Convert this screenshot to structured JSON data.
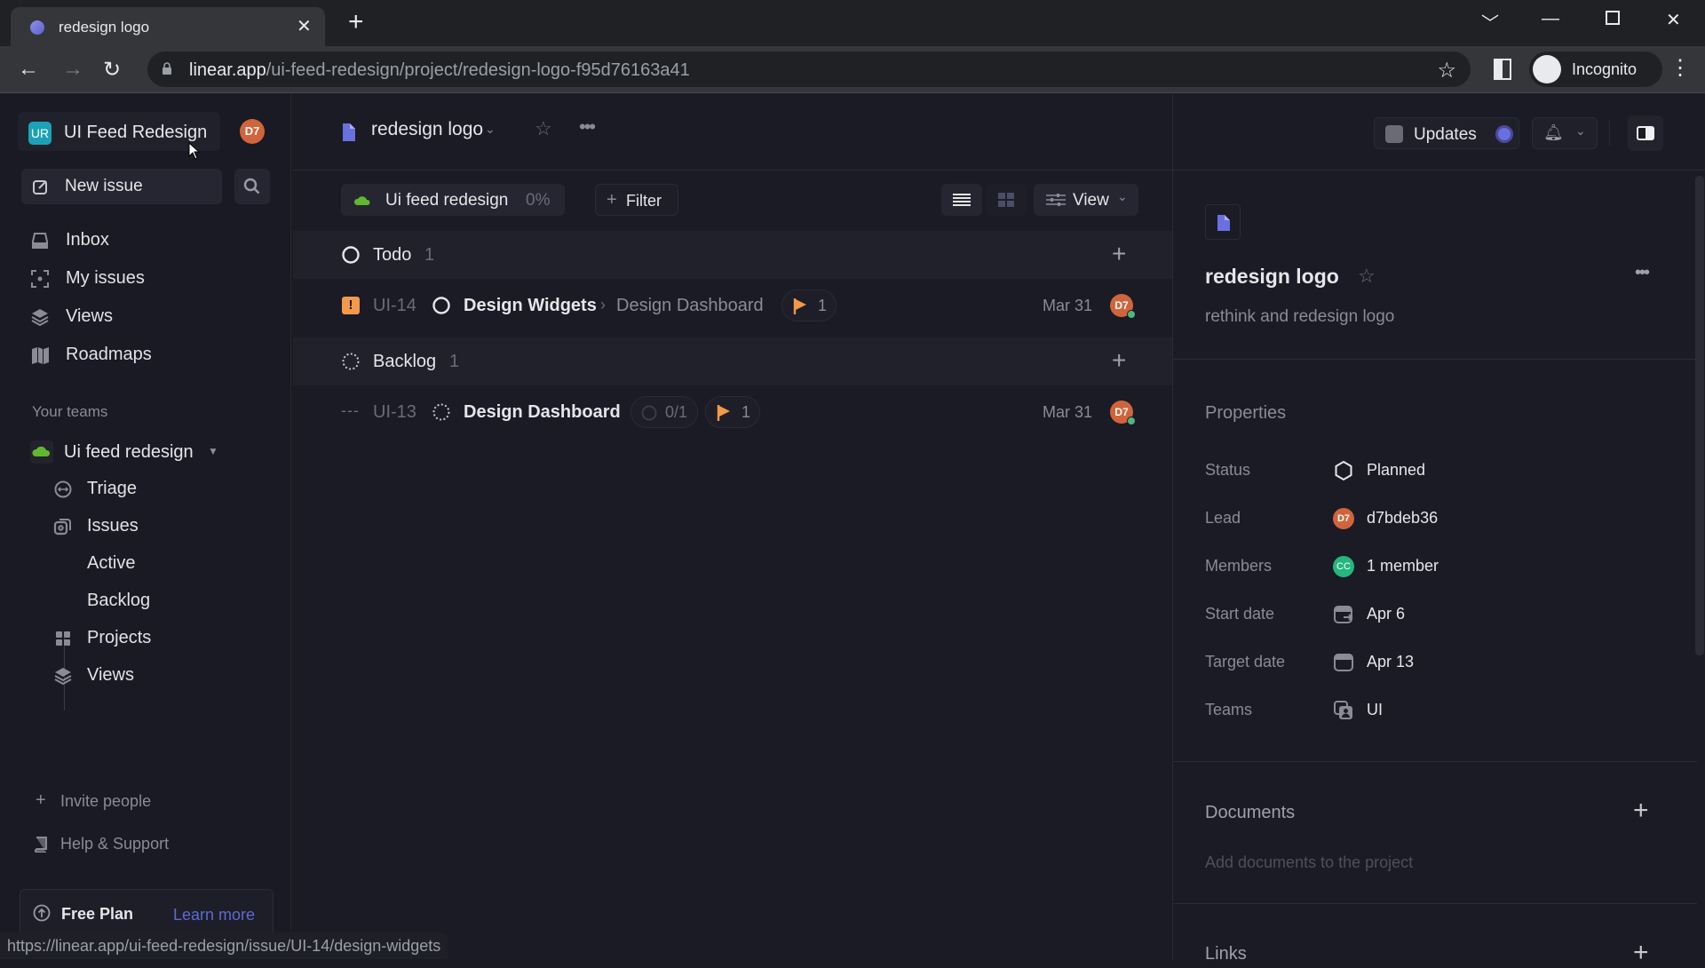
{
  "browser": {
    "tab_title": "redesign logo",
    "url_domain": "linear.app",
    "url_path": "/ui-feed-redesign/project/redesign-logo-f95d76163a41",
    "profile_label": "Incognito",
    "status_url": "https://linear.app/ui-feed-redesign/issue/UI-14/design-widgets"
  },
  "sidebar": {
    "workspace_initials": "UR",
    "workspace_name": "UI Feed Redesign",
    "user_initials": "D7",
    "new_issue_label": "New issue",
    "nav": [
      {
        "label": "Inbox",
        "icon": "inbox-icon"
      },
      {
        "label": "My issues",
        "icon": "my-issues-icon"
      },
      {
        "label": "Views",
        "icon": "views-icon"
      },
      {
        "label": "Roadmaps",
        "icon": "roadmaps-icon"
      }
    ],
    "teams_heading": "Your teams",
    "team_name": "Ui feed redesign",
    "team_items": [
      {
        "label": "Triage"
      },
      {
        "label": "Issues"
      },
      {
        "label": "Active"
      },
      {
        "label": "Backlog"
      },
      {
        "label": "Projects"
      },
      {
        "label": "Views"
      }
    ],
    "invite_label": "Invite people",
    "help_label": "Help & Support",
    "plan_label": "Free Plan",
    "learn_more_label": "Learn more"
  },
  "header": {
    "project_name": "redesign logo",
    "updates_label": "Updates"
  },
  "toolbar": {
    "team_chip_label": "Ui feed redesign",
    "team_chip_progress": "0%",
    "filter_label": "Filter",
    "view_label": "View"
  },
  "groups": [
    {
      "name": "Todo",
      "count": "1",
      "issues": [
        {
          "priority": "urgent",
          "id": "UI-14",
          "title": "Design Widgets",
          "parent": "Design Dashboard",
          "milestone_count": "1",
          "subissues": "",
          "date": "Mar 31",
          "assignee": "D7"
        }
      ]
    },
    {
      "name": "Backlog",
      "count": "1",
      "issues": [
        {
          "priority": "none",
          "id": "UI-13",
          "title": "Design Dashboard",
          "parent": "",
          "milestone_count": "1",
          "subissues": "0/1",
          "date": "Mar 31",
          "assignee": "D7"
        }
      ]
    }
  ],
  "details": {
    "title": "redesign logo",
    "description": "rethink and redesign logo",
    "properties_heading": "Properties",
    "properties": [
      {
        "label": "Status",
        "value": "Planned"
      },
      {
        "label": "Lead",
        "value": "d7bdeb36",
        "avatar": "D7"
      },
      {
        "label": "Members",
        "value": "1 member",
        "avatar": "CC"
      },
      {
        "label": "Start date",
        "value": "Apr 6"
      },
      {
        "label": "Target date",
        "value": "Apr 13"
      },
      {
        "label": "Teams",
        "value": "UI"
      }
    ],
    "documents_heading": "Documents",
    "documents_placeholder": "Add documents to the project",
    "links_heading": "Links"
  },
  "colors": {
    "accent": "#5e6ad2",
    "urgent": "#f2994a",
    "team_green": "#4cb782",
    "avatar_orange": "#d1643a",
    "avatar_green": "#26b57f"
  }
}
